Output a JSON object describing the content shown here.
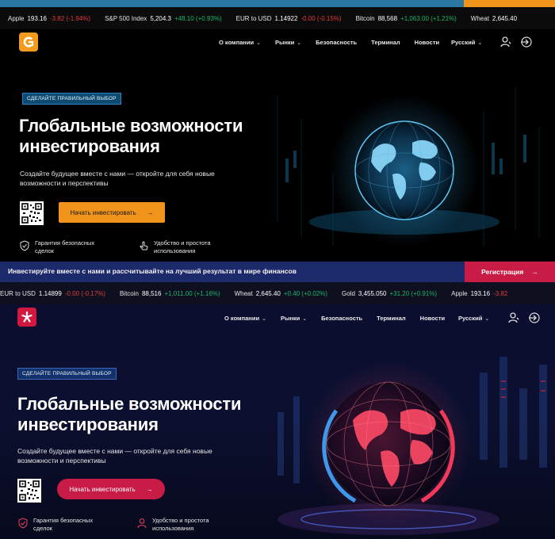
{
  "top": {
    "ticker": [
      {
        "name": "Apple",
        "price": "193.16",
        "change": "-3.82 (-1.94%)",
        "dir": "down"
      },
      {
        "name": "S&P 500 Index",
        "price": "5,204.3",
        "change": "+48.10 (+0.93%)",
        "dir": "up"
      },
      {
        "name": "EUR to USD",
        "price": "1.14922",
        "change": "-0.00 (-0.15%)",
        "dir": "down"
      },
      {
        "name": "Bitcoin",
        "price": "88,568",
        "change": "+1,063.00 (+1.21%)",
        "dir": "up"
      },
      {
        "name": "Wheat",
        "price": "2,645.40",
        "change": "",
        "dir": "up"
      }
    ],
    "nav": {
      "items": [
        "О компании",
        "Рынки",
        "Безопасность",
        "Терминал",
        "Новости"
      ],
      "language": "Русский"
    },
    "hero": {
      "badge": "СДЕЛАЙТЕ ПРАВИЛЬНЫЙ ВЫБОР",
      "headline_line1": "Глобальные возможности",
      "headline_line2": "инвестирования",
      "subtitle_line1": "Создайте будущее вместе с нами — откройте для себя новые",
      "subtitle_line2": "возможности и перспективы",
      "cta": "Начать инвестировать"
    },
    "features": [
      {
        "line1": "Гарантия безопасных",
        "line2": "сделок"
      },
      {
        "line1": "Удобство и простота",
        "line2": "использования"
      }
    ],
    "colors": {
      "accent": "#f0941c",
      "logo": "#f39b1c"
    }
  },
  "bottom": {
    "banner": {
      "text": "Инвестируйте вместе с нами и рассчитывайте на лучший результат в мире финансов",
      "register": "Регистрация"
    },
    "ticker": [
      {
        "name": "EUR to USD",
        "price": "1.14899",
        "change": "-0.00 (-0.17%)",
        "dir": "down"
      },
      {
        "name": "Bitcoin",
        "price": "88,516",
        "change": "+1,011.00 (+1.16%)",
        "dir": "up"
      },
      {
        "name": "Wheat",
        "price": "2,645.40",
        "change": "+0.40 (+0.02%)",
        "dir": "up"
      },
      {
        "name": "Gold",
        "price": "3,455.050",
        "change": "+31.20 (+0.91%)",
        "dir": "up"
      },
      {
        "name": "Apple",
        "price": "193.16",
        "change": "-3.82",
        "dir": "down"
      }
    ],
    "nav": {
      "items": [
        "О компании",
        "Рынки",
        "Безопасность",
        "Терминал",
        "Новости"
      ],
      "language": "Русский"
    },
    "hero": {
      "badge": "СДЕЛАЙТЕ ПРАВИЛЬНЫЙ ВЫБОР",
      "headline_line1": "Глобальные возможности",
      "headline_line2": "инвестирования",
      "subtitle_line1": "Создайте будущее вместе с нами — откройте для себя новые",
      "subtitle_line2": "возможности и перспективы",
      "cta": "Начать инвестировать"
    },
    "features": [
      {
        "line1": "Гарантия безопасных",
        "line2": "сделок"
      },
      {
        "line1": "Удобство и простота",
        "line2": "использования"
      }
    ],
    "colors": {
      "accent": "#c81b45",
      "banner": "#1c2a6b"
    }
  }
}
